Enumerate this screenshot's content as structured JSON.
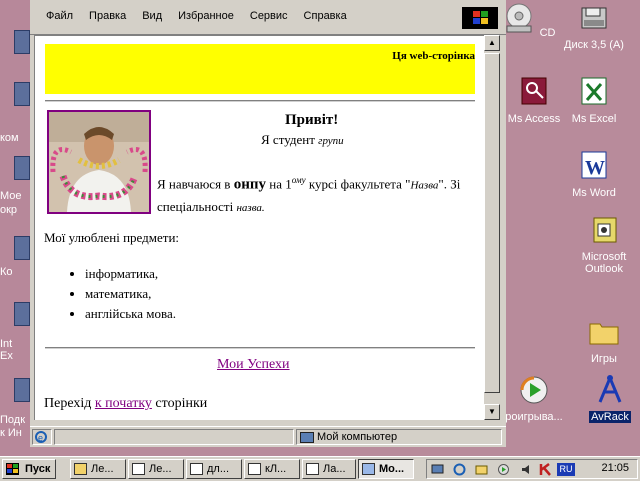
{
  "left_labels": [
    "ком",
    "Мое",
    "окр",
    "Ко",
    "Int",
    "Ex",
    "Подк",
    "к Ин"
  ],
  "menu": [
    "Файл",
    "Правка",
    "Вид",
    "Избранное",
    "Сервис",
    "Справка"
  ],
  "page": {
    "banner": "Ця web-сторінка",
    "greeting": "Привіт!",
    "student_prefix": "Я студент",
    "student_group": "групи",
    "para_1": "Я навчаюся в",
    "para_big": "онпу",
    "para_2": "на 1",
    "para_sup": "ому",
    "para_3": "курсі факультета \"",
    "faculty_name": "Назва",
    "para_4": "\". Зі спеціальності",
    "specialty": "назва.",
    "subjects_title": "Мої улюблені предмети:",
    "subjects": [
      "інформатика,",
      "математика,",
      "англійська мова."
    ],
    "success_link": "Мои Успехи",
    "go_top_prefix": "Перехід",
    "go_top_link": "к початку",
    "go_top_suffix": "сторінки"
  },
  "status": {
    "zone": "Мой компьютер"
  },
  "desktop_icons": [
    {
      "label": "CD",
      "icon": "cd-drive-icon"
    },
    {
      "label": "Диск 3,5 (A)",
      "icon": "floppy-drive-icon"
    },
    {
      "label": "Ms Access",
      "icon": "ms-access-icon"
    },
    {
      "label": "Ms Excel",
      "icon": "ms-excel-icon"
    },
    {
      "label": "Ms Word",
      "icon": "ms-word-icon"
    },
    {
      "label": "Microsoft Outlook",
      "icon": "outlook-icon"
    },
    {
      "label": "Игры",
      "icon": "folder-icon"
    },
    {
      "label": "роигрыва...",
      "icon": "media-player-icon"
    },
    {
      "label": "AvRack",
      "icon": "avrack-icon"
    }
  ],
  "taskbar": {
    "start": "Пуск",
    "buttons": [
      "Ле...",
      "Ле...",
      "дл...",
      "кЛ...",
      "Ла...",
      "Мо..."
    ],
    "clock": "21:05",
    "lang": "RU"
  },
  "colors": {
    "desktop": "#b88b9b",
    "banner": "#ffff00",
    "link_visited": "#800080",
    "selection": "#0a246a"
  }
}
